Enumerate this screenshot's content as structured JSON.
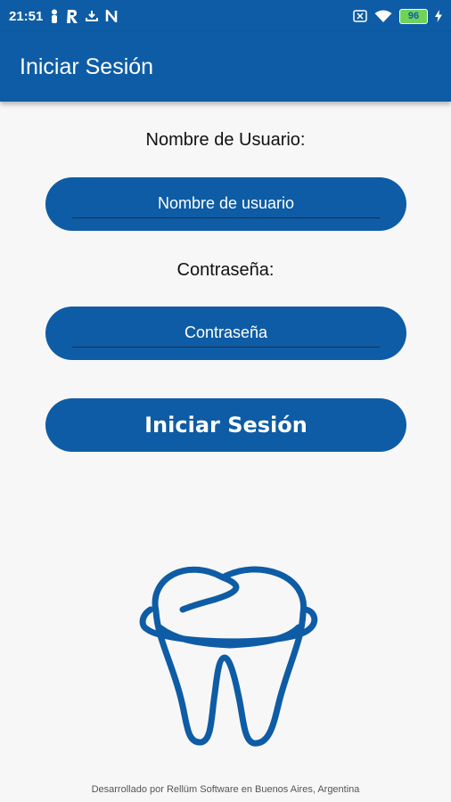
{
  "status_bar": {
    "time": "21:51",
    "battery": "96",
    "left_icons": [
      "person-icon",
      "r-app-icon",
      "download-icon",
      "n-app-icon"
    ],
    "right_icons": [
      "sim-x-icon",
      "wifi-icon",
      "battery-icon",
      "charging-icon"
    ]
  },
  "app_bar": {
    "title": "Iniciar Sesión"
  },
  "form": {
    "username_label": "Nombre de Usuario:",
    "username_placeholder": "Nombre de usuario",
    "username_value": "",
    "password_label": "Contraseña:",
    "password_placeholder": "Contraseña",
    "password_value": "",
    "submit_label": "Iniciar Sesión"
  },
  "logo": {
    "icon": "tooth-icon"
  },
  "footer": {
    "text": "Desarrollado por Rellüm Software en Buenos Aires, Argentina"
  },
  "colors": {
    "primary": "#0e5ca5",
    "background": "#f7f7f7",
    "text": "#111111"
  }
}
